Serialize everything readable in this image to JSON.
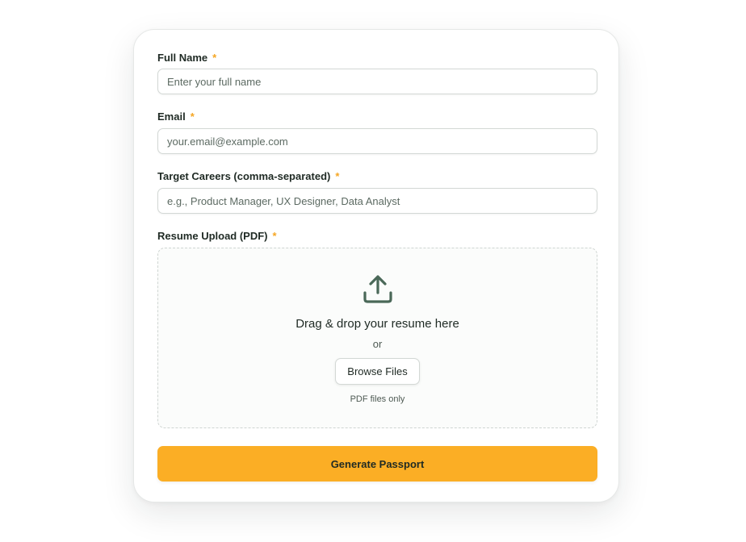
{
  "form": {
    "fields": [
      {
        "label": "Full Name",
        "required_marker": "*",
        "value": "",
        "placeholder": "Enter your full name"
      },
      {
        "label": "Email",
        "required_marker": "*",
        "value": "",
        "placeholder": "your.email@example.com"
      },
      {
        "label": "Target Careers (comma-separated)",
        "required_marker": "*",
        "value": "",
        "placeholder": "e.g., Product Manager, UX Designer, Data Analyst"
      }
    ],
    "upload": {
      "label": "Resume Upload (PDF)",
      "required_marker": "*",
      "icon": "upload-icon",
      "title": "Drag & drop your resume here",
      "or_text": "or",
      "browse_label": "Browse Files",
      "hint": "PDF files only"
    },
    "submit_label": "Generate Passport"
  },
  "colors": {
    "accent": "#fbae25",
    "required": "#f5a623",
    "icon": "#4a6858",
    "text": "#1f2a24"
  }
}
